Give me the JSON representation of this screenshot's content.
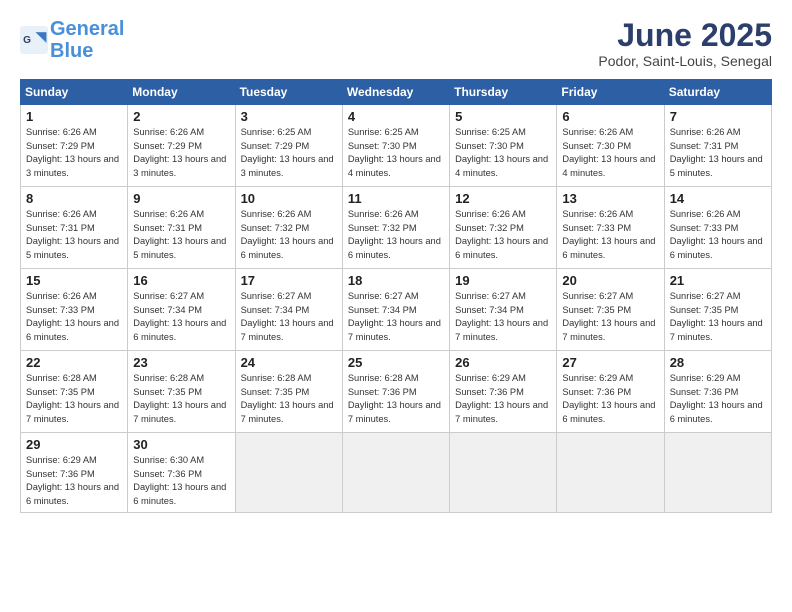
{
  "logo": {
    "line1": "General",
    "line2": "Blue"
  },
  "header": {
    "month": "June 2025",
    "location": "Podor, Saint-Louis, Senegal"
  },
  "weekdays": [
    "Sunday",
    "Monday",
    "Tuesday",
    "Wednesday",
    "Thursday",
    "Friday",
    "Saturday"
  ],
  "weeks": [
    [
      {
        "day": "1",
        "rise": "6:26 AM",
        "set": "7:29 PM",
        "daylight": "13 hours and 3 minutes."
      },
      {
        "day": "2",
        "rise": "6:26 AM",
        "set": "7:29 PM",
        "daylight": "13 hours and 3 minutes."
      },
      {
        "day": "3",
        "rise": "6:25 AM",
        "set": "7:29 PM",
        "daylight": "13 hours and 3 minutes."
      },
      {
        "day": "4",
        "rise": "6:25 AM",
        "set": "7:30 PM",
        "daylight": "13 hours and 4 minutes."
      },
      {
        "day": "5",
        "rise": "6:25 AM",
        "set": "7:30 PM",
        "daylight": "13 hours and 4 minutes."
      },
      {
        "day": "6",
        "rise": "6:26 AM",
        "set": "7:30 PM",
        "daylight": "13 hours and 4 minutes."
      },
      {
        "day": "7",
        "rise": "6:26 AM",
        "set": "7:31 PM",
        "daylight": "13 hours and 5 minutes."
      }
    ],
    [
      {
        "day": "8",
        "rise": "6:26 AM",
        "set": "7:31 PM",
        "daylight": "13 hours and 5 minutes."
      },
      {
        "day": "9",
        "rise": "6:26 AM",
        "set": "7:31 PM",
        "daylight": "13 hours and 5 minutes."
      },
      {
        "day": "10",
        "rise": "6:26 AM",
        "set": "7:32 PM",
        "daylight": "13 hours and 6 minutes."
      },
      {
        "day": "11",
        "rise": "6:26 AM",
        "set": "7:32 PM",
        "daylight": "13 hours and 6 minutes."
      },
      {
        "day": "12",
        "rise": "6:26 AM",
        "set": "7:32 PM",
        "daylight": "13 hours and 6 minutes."
      },
      {
        "day": "13",
        "rise": "6:26 AM",
        "set": "7:33 PM",
        "daylight": "13 hours and 6 minutes."
      },
      {
        "day": "14",
        "rise": "6:26 AM",
        "set": "7:33 PM",
        "daylight": "13 hours and 6 minutes."
      }
    ],
    [
      {
        "day": "15",
        "rise": "6:26 AM",
        "set": "7:33 PM",
        "daylight": "13 hours and 6 minutes."
      },
      {
        "day": "16",
        "rise": "6:27 AM",
        "set": "7:34 PM",
        "daylight": "13 hours and 6 minutes."
      },
      {
        "day": "17",
        "rise": "6:27 AM",
        "set": "7:34 PM",
        "daylight": "13 hours and 7 minutes."
      },
      {
        "day": "18",
        "rise": "6:27 AM",
        "set": "7:34 PM",
        "daylight": "13 hours and 7 minutes."
      },
      {
        "day": "19",
        "rise": "6:27 AM",
        "set": "7:34 PM",
        "daylight": "13 hours and 7 minutes."
      },
      {
        "day": "20",
        "rise": "6:27 AM",
        "set": "7:35 PM",
        "daylight": "13 hours and 7 minutes."
      },
      {
        "day": "21",
        "rise": "6:27 AM",
        "set": "7:35 PM",
        "daylight": "13 hours and 7 minutes."
      }
    ],
    [
      {
        "day": "22",
        "rise": "6:28 AM",
        "set": "7:35 PM",
        "daylight": "13 hours and 7 minutes."
      },
      {
        "day": "23",
        "rise": "6:28 AM",
        "set": "7:35 PM",
        "daylight": "13 hours and 7 minutes."
      },
      {
        "day": "24",
        "rise": "6:28 AM",
        "set": "7:35 PM",
        "daylight": "13 hours and 7 minutes."
      },
      {
        "day": "25",
        "rise": "6:28 AM",
        "set": "7:36 PM",
        "daylight": "13 hours and 7 minutes."
      },
      {
        "day": "26",
        "rise": "6:29 AM",
        "set": "7:36 PM",
        "daylight": "13 hours and 7 minutes."
      },
      {
        "day": "27",
        "rise": "6:29 AM",
        "set": "7:36 PM",
        "daylight": "13 hours and 6 minutes."
      },
      {
        "day": "28",
        "rise": "6:29 AM",
        "set": "7:36 PM",
        "daylight": "13 hours and 6 minutes."
      }
    ],
    [
      {
        "day": "29",
        "rise": "6:29 AM",
        "set": "7:36 PM",
        "daylight": "13 hours and 6 minutes."
      },
      {
        "day": "30",
        "rise": "6:30 AM",
        "set": "7:36 PM",
        "daylight": "13 hours and 6 minutes."
      },
      null,
      null,
      null,
      null,
      null
    ]
  ]
}
